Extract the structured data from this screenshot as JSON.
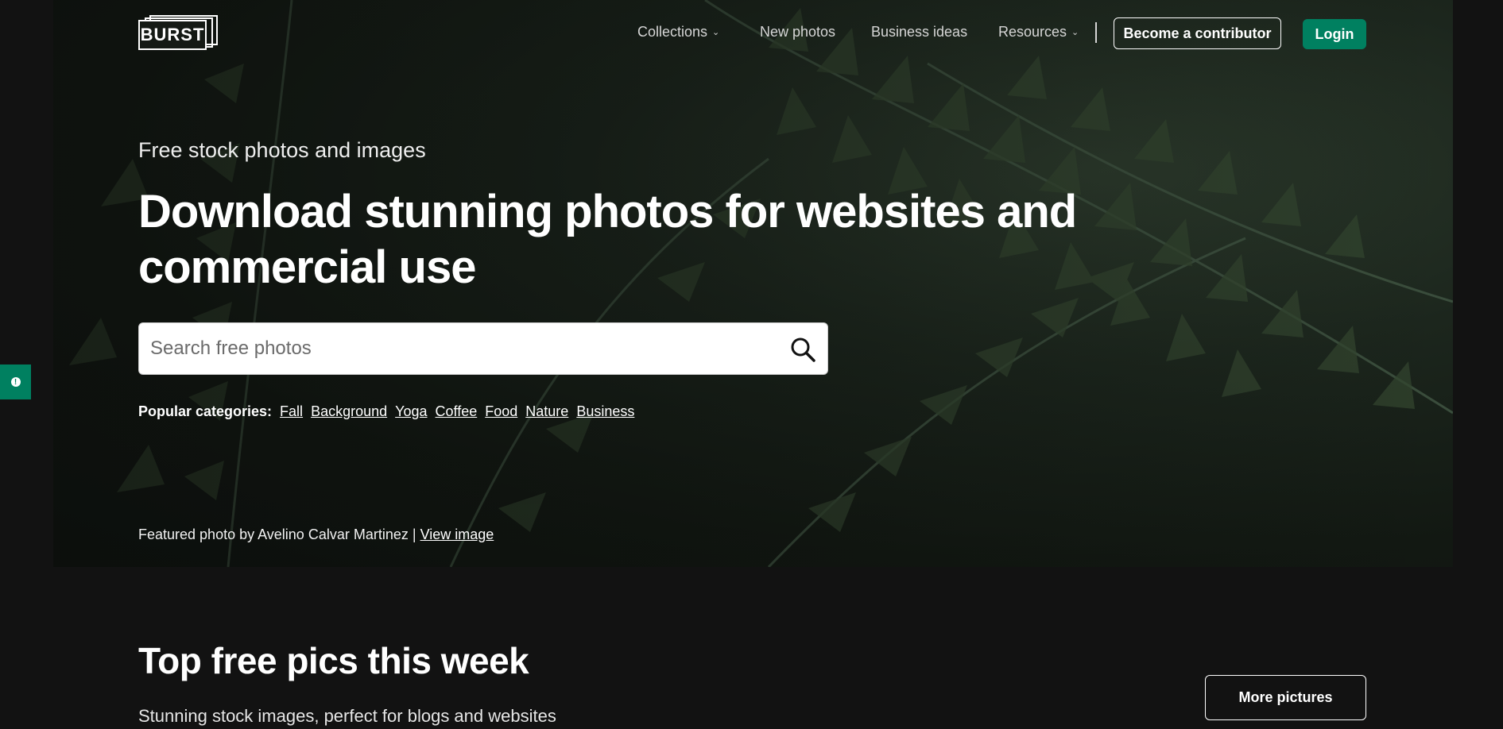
{
  "logo": {
    "text": "BURST"
  },
  "nav": {
    "collections": "Collections",
    "new_photos": "New photos",
    "business_ideas": "Business ideas",
    "resources": "Resources",
    "contributor": "Become a contributor",
    "login": "Login"
  },
  "hero": {
    "eyebrow": "Free stock photos and images",
    "headline": "Download stunning photos for websites and commercial use",
    "search_placeholder": "Search free photos",
    "popular_label": "Popular categories:",
    "categories": [
      "Fall",
      "Background",
      "Yoga",
      "Coffee",
      "Food",
      "Nature",
      "Business"
    ],
    "featured_text": "Featured photo by Avelino Calvar Martinez |",
    "featured_link": "View image"
  },
  "section": {
    "title": "Top free pics this week",
    "subtitle": "Stunning stock images, perfect for blogs and websites",
    "more_button": "More pictures"
  },
  "colors": {
    "accent": "#008060",
    "background": "#121212"
  },
  "icons": {
    "search": "search-icon",
    "chevron": "chevron-down-icon",
    "feedback": "info-icon"
  }
}
